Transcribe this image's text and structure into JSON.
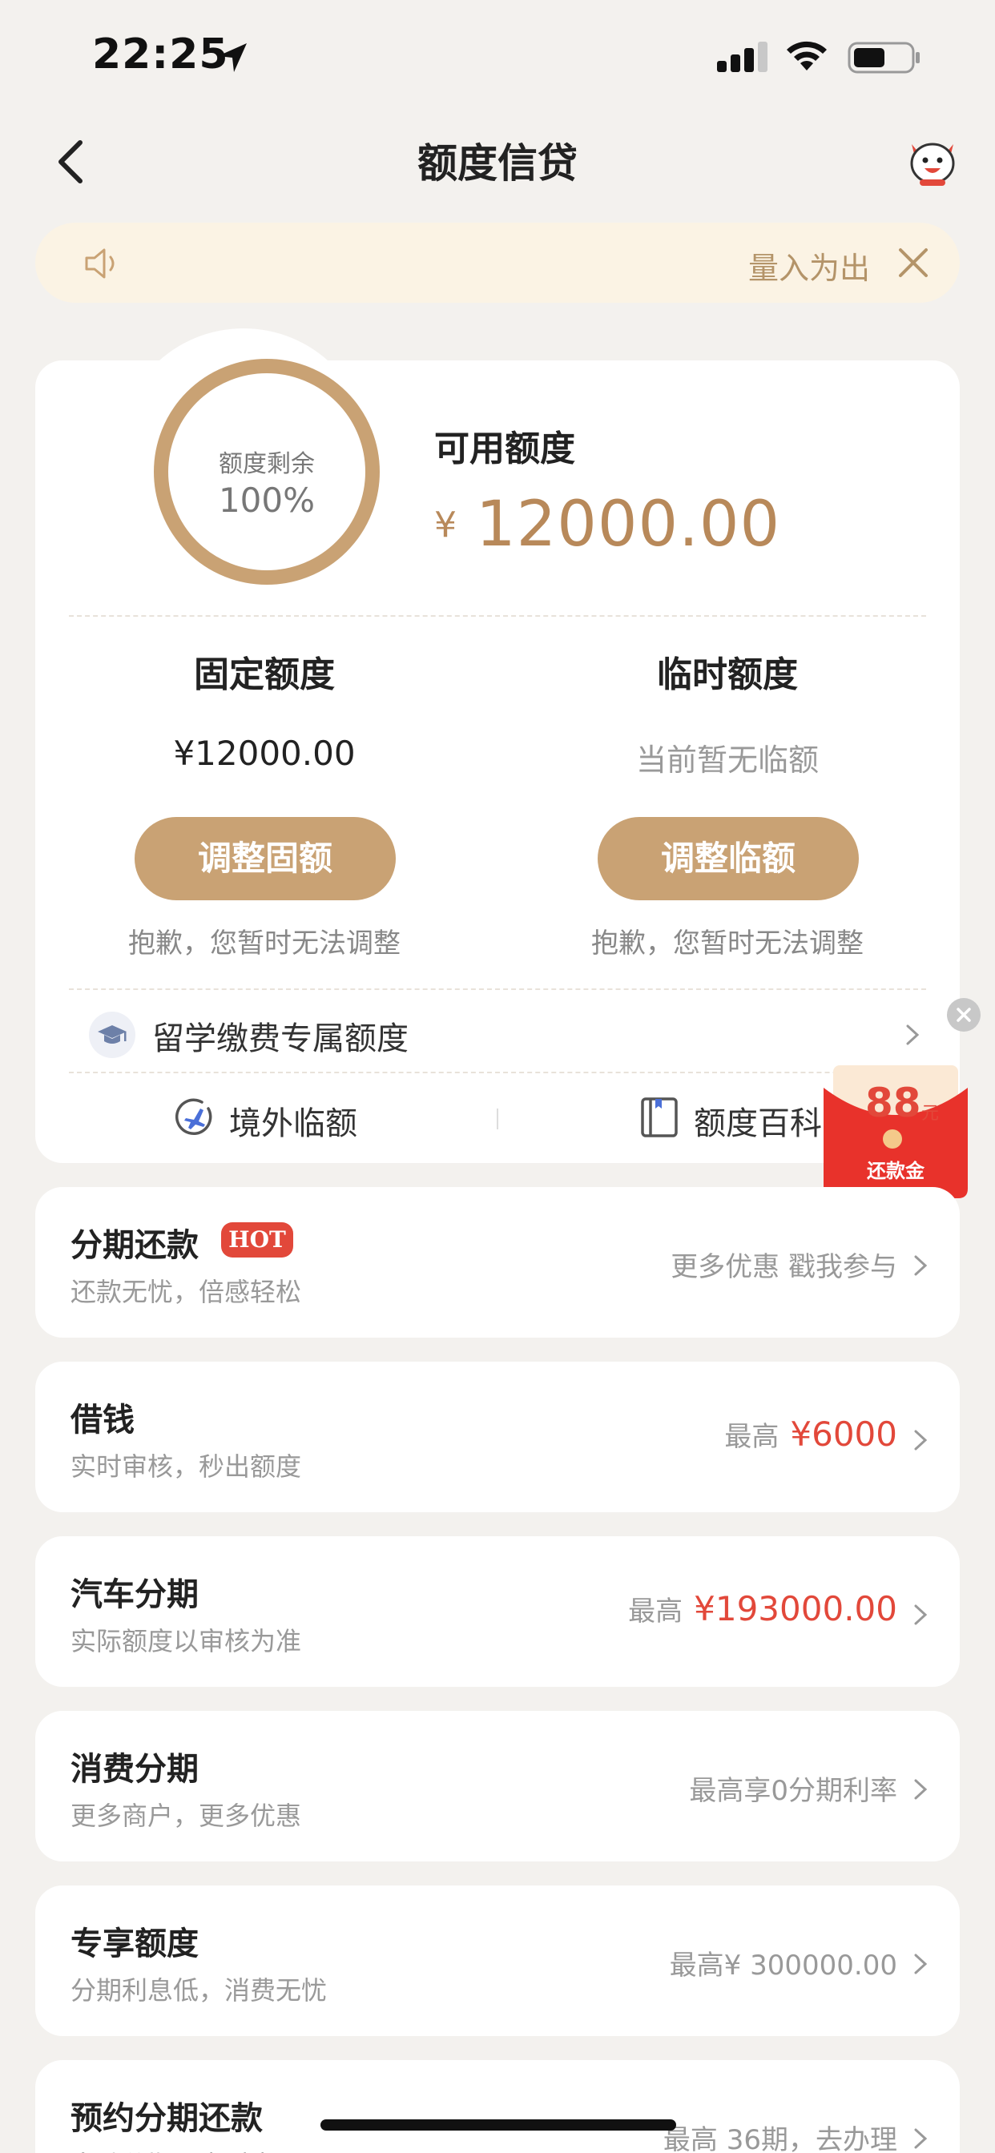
{
  "status_bar": {
    "time": "22:25"
  },
  "nav": {
    "title": "额度信贷"
  },
  "notice": {
    "text": "量入为出"
  },
  "credit": {
    "ring_label": "额度剩余",
    "ring_value": "100%",
    "remaining_fraction": 1.0,
    "available_label": "可用额度",
    "currency": "¥",
    "available_amount": "12000.00",
    "fixed": {
      "title": "固定额度",
      "amount": "¥12000.00",
      "button": "调整固额",
      "note": "抱歉，您暂时无法调整"
    },
    "temp": {
      "title": "临时额度",
      "amount": "当前暂无临额",
      "button": "调整临额",
      "note": "抱歉，您暂时无法调整"
    },
    "study_label": "留学缴费专属额度",
    "footer": [
      {
        "label": "境外临额"
      },
      {
        "label": "额度百科"
      }
    ]
  },
  "envelope": {
    "amount": "88",
    "unit": "元",
    "label": "还款金"
  },
  "list": [
    {
      "title": "分期还款",
      "badge": "HOT",
      "subtitle": "还款无忧，倍感轻松",
      "right_text": "更多优惠 戳我参与",
      "right_value": ""
    },
    {
      "title": "借钱",
      "subtitle": "实时审核，秒出额度",
      "right_text": "最高",
      "right_value": "¥6000"
    },
    {
      "title": "汽车分期",
      "subtitle": "实际额度以审核为准",
      "right_text": "最高",
      "right_value": "¥193000.00"
    },
    {
      "title": "消费分期",
      "subtitle": "更多商户，更多优惠",
      "right_text": "最高享0分期利率",
      "right_value": ""
    },
    {
      "title": "专享额度",
      "subtitle": "分期利息低，消费无忧",
      "right_text": "最高¥ 300000.00",
      "right_value": ""
    },
    {
      "title": "预约分期还款",
      "subtitle": "自动分期，省时省心",
      "right_text": "最高 36期，去办理",
      "right_value": ""
    }
  ],
  "colors": {
    "gold": "#c9a274",
    "gold_text": "#b8895a",
    "red": "#e2483a",
    "background": "#f3f1ee"
  }
}
